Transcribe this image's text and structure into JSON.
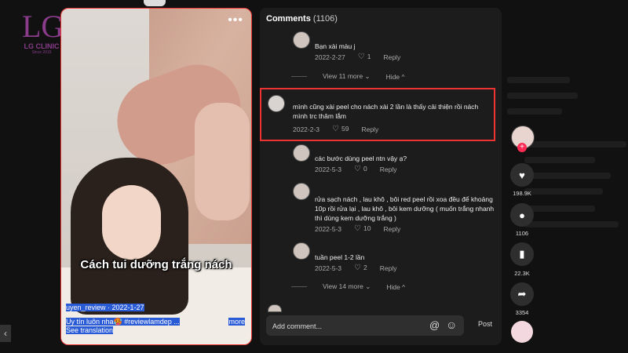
{
  "brand": {
    "mark": "LG",
    "name": "LG CLINIC",
    "since": "Since 2015"
  },
  "video": {
    "caption": "Cách tui dưỡng trắng nách",
    "author_date": "uyen_review · 2022-1-27",
    "description": "Uy tín luôn nha🥵 #reviewlamdep ...",
    "more": "more",
    "translation": "See translation",
    "menu_icon": "more-dots-icon"
  },
  "comments_panel": {
    "title": "Comments",
    "count": "(1106)",
    "comments": [
      {
        "text": "Bạn xài màu j",
        "date": "2022-2-27",
        "likes": "1",
        "reply": "Reply"
      },
      {
        "text": "mình cũng xài peel cho nách xài 2 lần là thấy cải thiện rồi nách mình trc thâm lắm",
        "date": "2022-2-3",
        "likes": "59",
        "reply": "Reply"
      },
      {
        "text": "các bước dùng peel ntn vậy ạ?",
        "date": "2022-5-3",
        "likes": "0",
        "reply": "Reply"
      },
      {
        "text": "rửa sạch nách , lau khô , bôi red peel rồi xoa đều để khoảng 10p rồi rửa lại , lau khô , bôi kem dưỡng ( muốn trắng nhanh thì dùng kem dưỡng trắng )",
        "date": "2022-5-3",
        "likes": "10",
        "reply": "Reply"
      },
      {
        "text": "tuần peel 1-2 lần",
        "date": "2022-5-3",
        "likes": "2",
        "reply": "Reply"
      }
    ],
    "view_more_1": "View 11 more",
    "hide_1": "Hide",
    "view_more_2": "View 14 more",
    "hide_2": "Hide",
    "input_placeholder": "Add comment...",
    "post": "Post"
  },
  "sidebar": {
    "likes": "198.9K",
    "comments": "1106",
    "saves": "22.3K",
    "shares": "3354"
  },
  "colors": {
    "highlight": "#ee3333",
    "plus": "#fe2c55",
    "selection": "#2a5bd7"
  }
}
